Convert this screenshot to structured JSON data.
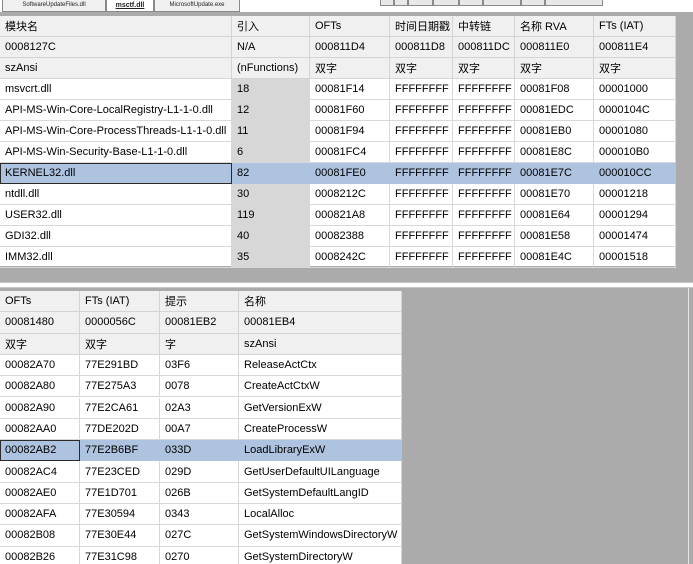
{
  "tabs": [
    {
      "label": "SoftwareUpdateFiles.dll",
      "active": false
    },
    {
      "label": "msctf.dll",
      "active": true
    },
    {
      "label": "MicrosoftUpdate.exe",
      "active": false
    }
  ],
  "import_modules": {
    "columns": [
      "模块名",
      "引入",
      "OFTs",
      "时间日期戳",
      "中转链",
      "名称 RVA",
      "FTs (IAT)"
    ],
    "meta_rows": [
      [
        "0008127C",
        "N/A",
        "000811D4",
        "000811D8",
        "000811DC",
        "000811E0",
        "000811E4"
      ],
      [
        "szAnsi",
        "(nFunctions)",
        "双字",
        "双字",
        "双字",
        "双字",
        "双字"
      ]
    ],
    "rows": [
      [
        "msvcrt.dll",
        "18",
        "00081F14",
        "FFFFFFFF",
        "FFFFFFFF",
        "00081F08",
        "00001000"
      ],
      [
        "API-MS-Win-Core-LocalRegistry-L1-1-0.dll",
        "12",
        "00081F60",
        "FFFFFFFF",
        "FFFFFFFF",
        "00081EDC",
        "0000104C"
      ],
      [
        "API-MS-Win-Core-ProcessThreads-L1-1-0.dll",
        "11",
        "00081F94",
        "FFFFFFFF",
        "FFFFFFFF",
        "00081EB0",
        "00001080"
      ],
      [
        "API-MS-Win-Security-Base-L1-1-0.dll",
        "6",
        "00081FC4",
        "FFFFFFFF",
        "FFFFFFFF",
        "00081E8C",
        "000010B0"
      ],
      [
        "KERNEL32.dll",
        "82",
        "00081FE0",
        "FFFFFFFF",
        "FFFFFFFF",
        "00081E7C",
        "000010CC"
      ],
      [
        "ntdll.dll",
        "30",
        "0008212C",
        "FFFFFFFF",
        "FFFFFFFF",
        "00081E70",
        "00001218"
      ],
      [
        "USER32.dll",
        "119",
        "000821A8",
        "FFFFFFFF",
        "FFFFFFFF",
        "00081E64",
        "00001294"
      ],
      [
        "GDI32.dll",
        "40",
        "00082388",
        "FFFFFFFF",
        "FFFFFFFF",
        "00081E58",
        "00001474"
      ],
      [
        "IMM32.dll",
        "35",
        "0008242C",
        "FFFFFFFF",
        "FFFFFFFF",
        "00081E4C",
        "00001518"
      ]
    ],
    "selected_index": 4
  },
  "import_functions": {
    "columns": [
      "OFTs",
      "FTs (IAT)",
      "提示",
      "名称"
    ],
    "meta_rows": [
      [
        "00081480",
        "0000056C",
        "00081EB2",
        "00081EB4"
      ],
      [
        "双字",
        "双字",
        "字",
        "szAnsi"
      ]
    ],
    "rows": [
      [
        "00082A70",
        "77E291BD",
        "03F6",
        "ReleaseActCtx"
      ],
      [
        "00082A80",
        "77E275A3",
        "0078",
        "CreateActCtxW"
      ],
      [
        "00082A90",
        "77E2CA61",
        "02A3",
        "GetVersionExW"
      ],
      [
        "00082AA0",
        "77DE202D",
        "00A7",
        "CreateProcessW"
      ],
      [
        "00082AB2",
        "77E2B6BF",
        "033D",
        "LoadLibraryExW"
      ],
      [
        "00082AC4",
        "77E23CED",
        "029D",
        "GetUserDefaultUILanguage"
      ],
      [
        "00082AE0",
        "77E1D701",
        "026B",
        "GetSystemDefaultLangID"
      ],
      [
        "00082AFA",
        "77E30594",
        "0343",
        "LocalAlloc"
      ],
      [
        "00082B08",
        "77E30E44",
        "027C",
        "GetSystemWindowsDirectoryW"
      ],
      [
        "00082B26",
        "77E31C98",
        "0270",
        "GetSystemDirectoryW"
      ]
    ],
    "selected_index": 4
  },
  "colors": {
    "selected_row": "#aec3df",
    "meta_row": "#f0f0f0",
    "background": "#ababab"
  }
}
